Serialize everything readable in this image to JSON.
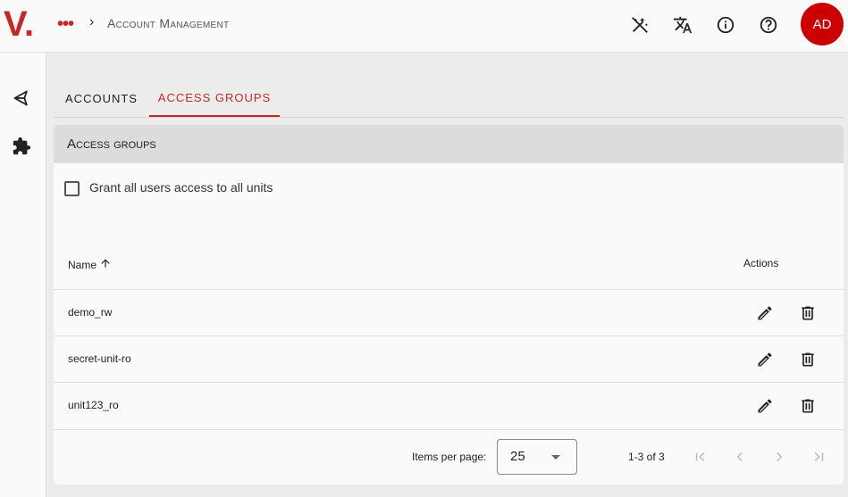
{
  "header": {
    "logo": "V",
    "logo_dot": ".",
    "menu": "•••",
    "crumb_sep": "›",
    "breadcrumb": "Account Management",
    "avatar": "AD",
    "icons": [
      "magic-off-icon",
      "translate-icon",
      "info-icon",
      "help-icon"
    ]
  },
  "sidebar": {
    "icons": [
      "unity-icon",
      "extension-icon"
    ]
  },
  "tabs": [
    {
      "label": "ACCOUNTS",
      "active": false
    },
    {
      "label": "ACCESS GROUPS",
      "active": true
    }
  ],
  "card": {
    "title": "Access groups",
    "grant_label": "Grant all users access to all units",
    "grant_checked": false
  },
  "table": {
    "col_name": "Name",
    "col_actions": "Actions",
    "rows": [
      {
        "name": "demo_rw"
      },
      {
        "name": "secret-unit-ro"
      },
      {
        "name": "unit123_ro"
      }
    ]
  },
  "pagination": {
    "items_per_page_label": "Items per page:",
    "items_per_page": "25",
    "range": "1-3 of 3"
  },
  "colors": {
    "accent": "#c62828",
    "avatar_bg": "#cc0000"
  }
}
